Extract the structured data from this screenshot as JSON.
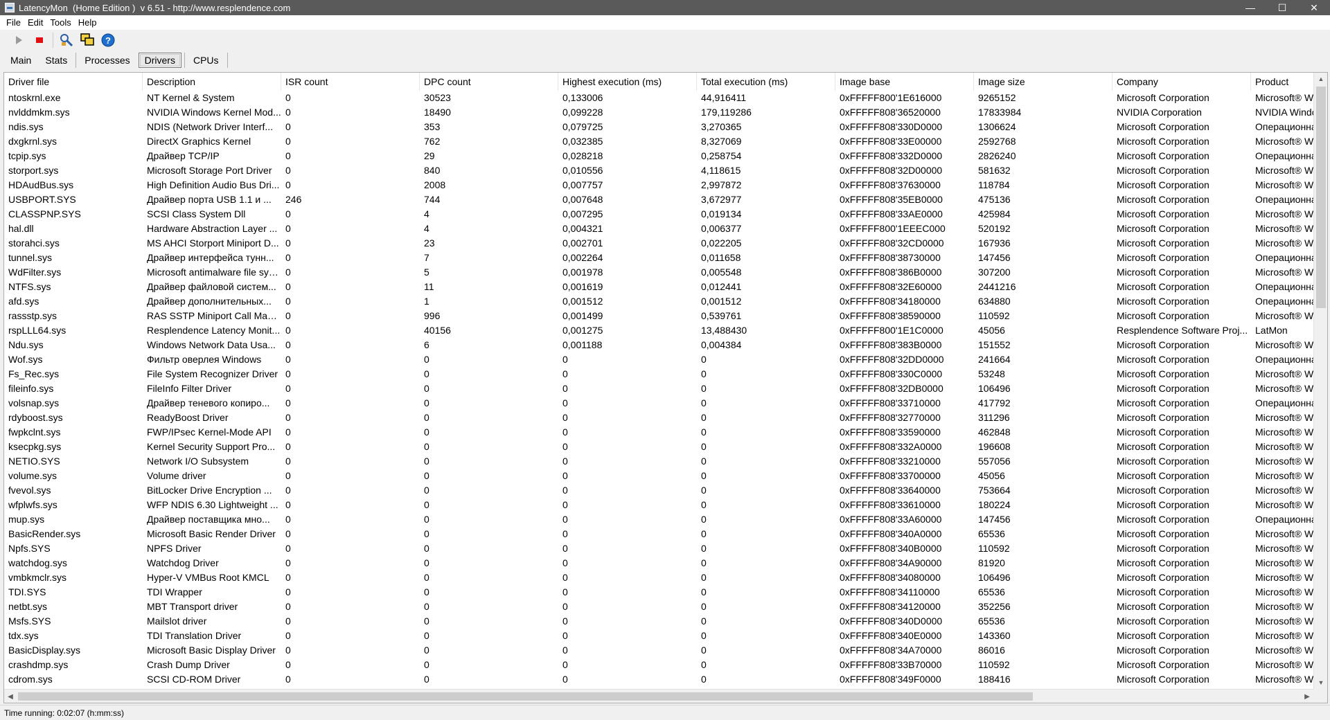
{
  "window": {
    "title": "LatencyMon  (Home Edition )  v 6.51 - http://www.resplendence.com",
    "controls": {
      "minimize": "—",
      "maximize": "☐",
      "close": "✕"
    }
  },
  "menu": [
    "File",
    "Edit",
    "Tools",
    "Help"
  ],
  "toolbar": {
    "buttons": [
      {
        "name": "start-icon"
      },
      {
        "name": "stop-icon"
      },
      {
        "name": "analyze-icon"
      },
      {
        "name": "windows-icon"
      },
      {
        "name": "help-icon"
      }
    ]
  },
  "tabs": [
    {
      "label": "Main",
      "active": false
    },
    {
      "label": "Stats",
      "active": false
    },
    {
      "label": "Processes",
      "active": false
    },
    {
      "label": "Drivers",
      "active": true
    },
    {
      "label": "CPUs",
      "active": false
    }
  ],
  "table": {
    "columns": [
      "Driver file",
      "Description",
      "ISR count",
      "DPC count",
      "Highest execution (ms)",
      "Total execution (ms)",
      "Image base",
      "Image size",
      "Company",
      "Product"
    ],
    "rows": [
      [
        "ntoskrnl.exe",
        "NT Kernel & System",
        "0",
        "30523",
        "0,133006",
        "44,916411",
        "0xFFFFF800'1E616000",
        "9265152",
        "Microsoft Corporation",
        "Microsoft® W"
      ],
      [
        "nvlddmkm.sys",
        "NVIDIA Windows Kernel Mod...",
        "0",
        "18490",
        "0,099228",
        "179,119286",
        "0xFFFFF808'36520000",
        "17833984",
        "NVIDIA Corporation",
        "NVIDIA Windc"
      ],
      [
        "ndis.sys",
        "NDIS (Network Driver Interf...",
        "0",
        "353",
        "0,079725",
        "3,270365",
        "0xFFFFF808'330D0000",
        "1306624",
        "Microsoft Corporation",
        "Операционна"
      ],
      [
        "dxgkrnl.sys",
        "DirectX Graphics Kernel",
        "0",
        "762",
        "0,032385",
        "8,327069",
        "0xFFFFF808'33E00000",
        "2592768",
        "Microsoft Corporation",
        "Microsoft® W"
      ],
      [
        "tcpip.sys",
        "Драйвер TCP/IP",
        "0",
        "29",
        "0,028218",
        "0,258754",
        "0xFFFFF808'332D0000",
        "2826240",
        "Microsoft Corporation",
        "Операционна"
      ],
      [
        "storport.sys",
        "Microsoft Storage Port Driver",
        "0",
        "840",
        "0,010556",
        "4,118615",
        "0xFFFFF808'32D00000",
        "581632",
        "Microsoft Corporation",
        "Microsoft® W"
      ],
      [
        "HDAudBus.sys",
        "High Definition Audio Bus Dri...",
        "0",
        "2008",
        "0,007757",
        "2,997872",
        "0xFFFFF808'37630000",
        "118784",
        "Microsoft Corporation",
        "Microsoft® W"
      ],
      [
        "USBPORT.SYS",
        "Драйвер порта USB 1.1 и ...",
        "246",
        "744",
        "0,007648",
        "3,672977",
        "0xFFFFF808'35EB0000",
        "475136",
        "Microsoft Corporation",
        "Операционна"
      ],
      [
        "CLASSPNP.SYS",
        "SCSI Class System Dll",
        "0",
        "4",
        "0,007295",
        "0,019134",
        "0xFFFFF808'33AE0000",
        "425984",
        "Microsoft Corporation",
        "Microsoft® W"
      ],
      [
        "hal.dll",
        "Hardware Abstraction Layer ...",
        "0",
        "4",
        "0,004321",
        "0,006377",
        "0xFFFFF800'1EEEC000",
        "520192",
        "Microsoft Corporation",
        "Microsoft® W"
      ],
      [
        "storahci.sys",
        "MS AHCI Storport Miniport D...",
        "0",
        "23",
        "0,002701",
        "0,022205",
        "0xFFFFF808'32CD0000",
        "167936",
        "Microsoft Corporation",
        "Microsoft® W"
      ],
      [
        "tunnel.sys",
        "Драйвер интерфейса тунн...",
        "0",
        "7",
        "0,002264",
        "0,011658",
        "0xFFFFF808'38730000",
        "147456",
        "Microsoft Corporation",
        "Операционна"
      ],
      [
        "WdFilter.sys",
        "Microsoft antimalware file sys...",
        "0",
        "5",
        "0,001978",
        "0,005548",
        "0xFFFFF808'386B0000",
        "307200",
        "Microsoft Corporation",
        "Microsoft® W"
      ],
      [
        "NTFS.sys",
        "Драйвер файловой систем...",
        "0",
        "11",
        "0,001619",
        "0,012441",
        "0xFFFFF808'32E60000",
        "2441216",
        "Microsoft Corporation",
        "Операционна"
      ],
      [
        "afd.sys",
        "Драйвер дополнительных...",
        "0",
        "1",
        "0,001512",
        "0,001512",
        "0xFFFFF808'34180000",
        "634880",
        "Microsoft Corporation",
        "Операционна"
      ],
      [
        "rassstp.sys",
        "RAS SSTP Miniport Call Mana...",
        "0",
        "996",
        "0,001499",
        "0,539761",
        "0xFFFFF808'38590000",
        "110592",
        "Microsoft Corporation",
        "Microsoft® W"
      ],
      [
        "rspLLL64.sys",
        "Resplendence Latency Monit...",
        "0",
        "40156",
        "0,001275",
        "13,488430",
        "0xFFFFF800'1E1C0000",
        "45056",
        "Resplendence Software Proj...",
        "LatMon"
      ],
      [
        "Ndu.sys",
        "Windows Network Data Usa...",
        "0",
        "6",
        "0,001188",
        "0,004384",
        "0xFFFFF808'383B0000",
        "151552",
        "Microsoft Corporation",
        "Microsoft® W"
      ],
      [
        "Wof.sys",
        "Фильтр оверлея Windows",
        "0",
        "0",
        "0",
        "0",
        "0xFFFFF808'32DD0000",
        "241664",
        "Microsoft Corporation",
        "Операционна"
      ],
      [
        "Fs_Rec.sys",
        "File System Recognizer Driver",
        "0",
        "0",
        "0",
        "0",
        "0xFFFFF808'330C0000",
        "53248",
        "Microsoft Corporation",
        "Microsoft® W"
      ],
      [
        "fileinfo.sys",
        "FileInfo Filter Driver",
        "0",
        "0",
        "0",
        "0",
        "0xFFFFF808'32DB0000",
        "106496",
        "Microsoft Corporation",
        "Microsoft® W"
      ],
      [
        "volsnap.sys",
        "Драйвер теневого копиро...",
        "0",
        "0",
        "0",
        "0",
        "0xFFFFF808'33710000",
        "417792",
        "Microsoft Corporation",
        "Операционна"
      ],
      [
        "rdyboost.sys",
        "ReadyBoost Driver",
        "0",
        "0",
        "0",
        "0",
        "0xFFFFF808'32770000",
        "311296",
        "Microsoft Corporation",
        "Microsoft® W"
      ],
      [
        "fwpkclnt.sys",
        "FWP/IPsec Kernel-Mode API",
        "0",
        "0",
        "0",
        "0",
        "0xFFFFF808'33590000",
        "462848",
        "Microsoft Corporation",
        "Microsoft® W"
      ],
      [
        "ksecpkg.sys",
        "Kernel Security Support Pro...",
        "0",
        "0",
        "0",
        "0",
        "0xFFFFF808'332A0000",
        "196608",
        "Microsoft Corporation",
        "Microsoft® W"
      ],
      [
        "NETIO.SYS",
        "Network I/O Subsystem",
        "0",
        "0",
        "0",
        "0",
        "0xFFFFF808'33210000",
        "557056",
        "Microsoft Corporation",
        "Microsoft® W"
      ],
      [
        "volume.sys",
        "Volume driver",
        "0",
        "0",
        "0",
        "0",
        "0xFFFFF808'33700000",
        "45056",
        "Microsoft Corporation",
        "Microsoft® W"
      ],
      [
        "fvevol.sys",
        "BitLocker Drive Encryption ...",
        "0",
        "0",
        "0",
        "0",
        "0xFFFFF808'33640000",
        "753664",
        "Microsoft Corporation",
        "Microsoft® W"
      ],
      [
        "wfplwfs.sys",
        "WFP NDIS 6.30 Lightweight ...",
        "0",
        "0",
        "0",
        "0",
        "0xFFFFF808'33610000",
        "180224",
        "Microsoft Corporation",
        "Microsoft® W"
      ],
      [
        "mup.sys",
        "Драйвер поставщика мно...",
        "0",
        "0",
        "0",
        "0",
        "0xFFFFF808'33A60000",
        "147456",
        "Microsoft Corporation",
        "Операционна"
      ],
      [
        "BasicRender.sys",
        "Microsoft Basic Render Driver",
        "0",
        "0",
        "0",
        "0",
        "0xFFFFF808'340A0000",
        "65536",
        "Microsoft Corporation",
        "Microsoft® W"
      ],
      [
        "Npfs.SYS",
        "NPFS Driver",
        "0",
        "0",
        "0",
        "0",
        "0xFFFFF808'340B0000",
        "110592",
        "Microsoft Corporation",
        "Microsoft® W"
      ],
      [
        "watchdog.sys",
        "Watchdog Driver",
        "0",
        "0",
        "0",
        "0",
        "0xFFFFF808'34A90000",
        "81920",
        "Microsoft Corporation",
        "Microsoft® W"
      ],
      [
        "vmbkmclr.sys",
        "Hyper-V VMBus Root KMCL",
        "0",
        "0",
        "0",
        "0",
        "0xFFFFF808'34080000",
        "106496",
        "Microsoft Corporation",
        "Microsoft® W"
      ],
      [
        "TDI.SYS",
        "TDI Wrapper",
        "0",
        "0",
        "0",
        "0",
        "0xFFFFF808'34110000",
        "65536",
        "Microsoft Corporation",
        "Microsoft® W"
      ],
      [
        "netbt.sys",
        "MBT Transport driver",
        "0",
        "0",
        "0",
        "0",
        "0xFFFFF808'34120000",
        "352256",
        "Microsoft Corporation",
        "Microsoft® W"
      ],
      [
        "Msfs.SYS",
        "Mailslot driver",
        "0",
        "0",
        "0",
        "0",
        "0xFFFFF808'340D0000",
        "65536",
        "Microsoft Corporation",
        "Microsoft® W"
      ],
      [
        "tdx.sys",
        "TDI Translation Driver",
        "0",
        "0",
        "0",
        "0",
        "0xFFFFF808'340E0000",
        "143360",
        "Microsoft Corporation",
        "Microsoft® W"
      ],
      [
        "BasicDisplay.sys",
        "Microsoft Basic Display Driver",
        "0",
        "0",
        "0",
        "0",
        "0xFFFFF808'34A70000",
        "86016",
        "Microsoft Corporation",
        "Microsoft® W"
      ],
      [
        "crashdmp.sys",
        "Crash Dump Driver",
        "0",
        "0",
        "0",
        "0",
        "0xFFFFF808'33B70000",
        "110592",
        "Microsoft Corporation",
        "Microsoft® W"
      ],
      [
        "cdrom.sys",
        "SCSI CD-ROM Driver",
        "0",
        "0",
        "0",
        "0",
        "0xFFFFF808'349F0000",
        "188416",
        "Microsoft Corporation",
        "Microsoft® W"
      ]
    ]
  },
  "status": {
    "text": "Time running: 0:02:07  (h:mm:ss)"
  },
  "colors": {
    "titlebar": "#5a5a5a",
    "stop": "#e01010",
    "help": "#1e6fd0"
  }
}
